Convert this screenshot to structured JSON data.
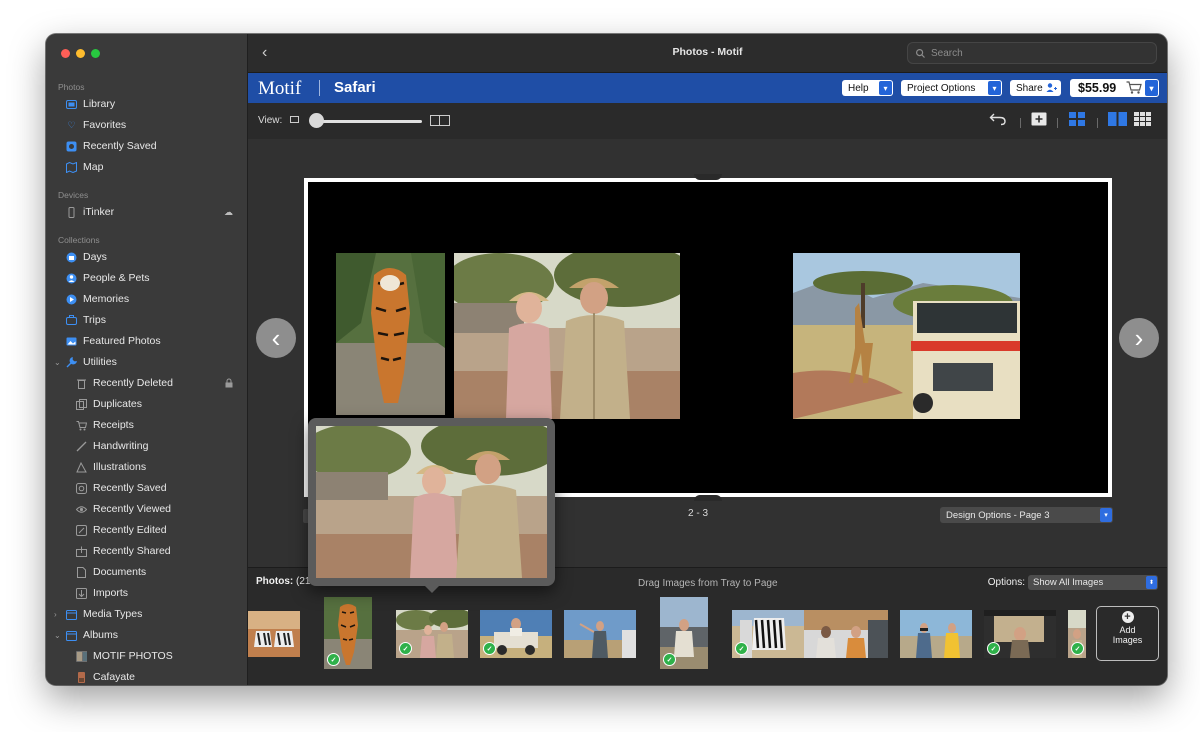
{
  "window": {
    "title": "Photos - Motif",
    "search_placeholder": "Search"
  },
  "sidebar": {
    "sections": [
      {
        "header": "Photos",
        "items": [
          {
            "label": "Library",
            "icon": "library-icon"
          },
          {
            "label": "Favorites",
            "icon": "heart-icon"
          },
          {
            "label": "Recently Saved",
            "icon": "recently-saved-icon"
          },
          {
            "label": "Map",
            "icon": "map-icon"
          }
        ]
      },
      {
        "header": "Devices",
        "items": [
          {
            "label": "iTinker",
            "icon": "phone-icon",
            "trailing_icon": "cloud-icon"
          }
        ]
      },
      {
        "header": "Collections",
        "items": [
          {
            "label": "Days",
            "icon": "days-icon"
          },
          {
            "label": "People & Pets",
            "icon": "people-icon"
          },
          {
            "label": "Memories",
            "icon": "memories-icon"
          },
          {
            "label": "Trips",
            "icon": "trips-icon"
          },
          {
            "label": "Featured Photos",
            "icon": "featured-photos-icon"
          },
          {
            "label": "Utilities",
            "icon": "utilities-icon",
            "expanded": true
          }
        ]
      },
      {
        "header": "",
        "items": [
          {
            "label": "Recently Deleted",
            "icon": "trash-icon",
            "trailing_icon": "lock-icon"
          },
          {
            "label": "Duplicates",
            "icon": "duplicates-icon"
          },
          {
            "label": "Receipts",
            "icon": "receipts-icon"
          },
          {
            "label": "Handwriting",
            "icon": "handwriting-icon"
          },
          {
            "label": "Illustrations",
            "icon": "illustrations-icon"
          },
          {
            "label": "Recently Saved",
            "icon": "recently-saved-icon"
          },
          {
            "label": "Recently Viewed",
            "icon": "eye-icon"
          },
          {
            "label": "Recently Edited",
            "icon": "edit-icon"
          },
          {
            "label": "Recently Shared",
            "icon": "share-icon"
          },
          {
            "label": "Documents",
            "icon": "documents-icon"
          },
          {
            "label": "Imports",
            "icon": "imports-icon"
          }
        ]
      },
      {
        "header": "",
        "items": [
          {
            "label": "Media Types",
            "icon": "media-types-icon",
            "expanded": false
          },
          {
            "label": "Albums",
            "icon": "albums-icon",
            "expanded": true
          },
          {
            "label": "MOTIF PHOTOS",
            "icon": "album-thumb-icon"
          },
          {
            "label": "Cafayate",
            "icon": "album-thumb-icon"
          }
        ]
      }
    ]
  },
  "motif": {
    "logo": "Motif",
    "project_name": "Safari",
    "help_label": "Help",
    "project_options_label": "Project Options",
    "share_label": "Share",
    "price": "$55.99"
  },
  "view_bar": {
    "label": "View:",
    "zoom_level": 0.0
  },
  "canvas": {
    "page_range": "2 - 3",
    "design_options_label": "Design Options - Page 3"
  },
  "tray": {
    "photos_label": "Photos:",
    "photos_count": "(21 d",
    "drag_hint": "Drag Images from Tray to Page",
    "options_label": "Options:",
    "filter_selected": "Show All Images",
    "add_images_label_line1": "Add",
    "add_images_label_line2": "Images",
    "thumbnails": [
      {
        "subject": "zebras",
        "used": false
      },
      {
        "subject": "tiger",
        "used": true
      },
      {
        "subject": "couple",
        "used": true
      },
      {
        "subject": "safari-jeep",
        "used": true
      },
      {
        "subject": "man-pointing",
        "used": false
      },
      {
        "subject": "woman-in-car",
        "used": true
      },
      {
        "subject": "zebra-and-tourists",
        "used": true
      },
      {
        "subject": "couple-with-binoculars",
        "used": false
      },
      {
        "subject": "couple-in-vehicle",
        "used": true
      },
      {
        "subject": "partial-photo",
        "used": true
      }
    ]
  },
  "colors": {
    "motif_blue": "#1f4ea6",
    "dropdown_blue": "#2364d8",
    "used_check_green": "#2fb14a"
  }
}
